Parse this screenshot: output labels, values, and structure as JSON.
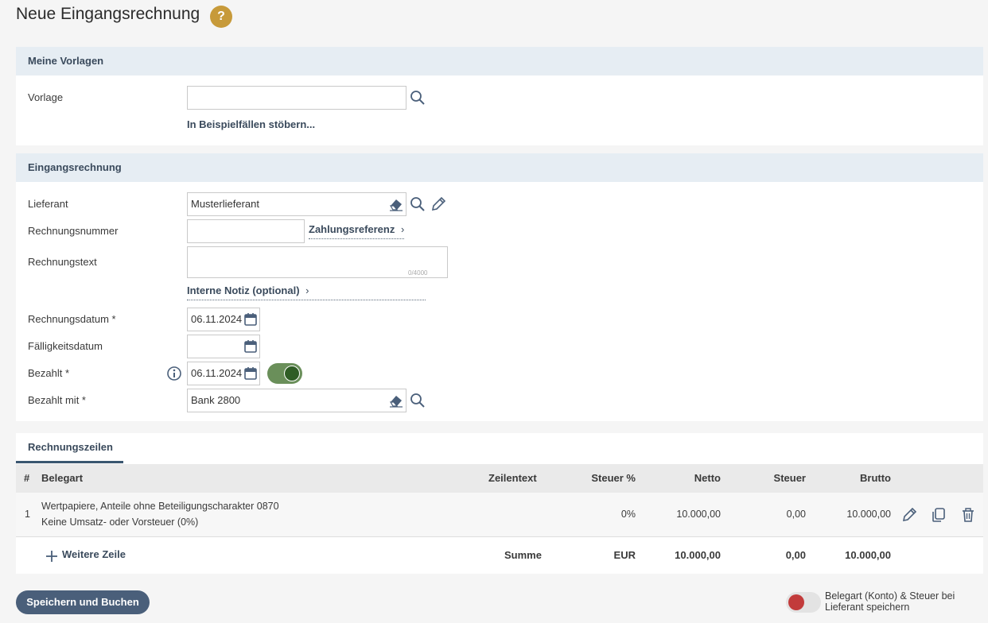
{
  "page": {
    "title": "Neue Eingangsrechnung",
    "help": "?"
  },
  "templates": {
    "header": "Meine Vorlagen",
    "vorlage_label": "Vorlage",
    "vorlage_value": "",
    "browse_link": "In Beispielfällen stöbern..."
  },
  "invoice": {
    "header": "Eingangsrechnung",
    "lieferant_label": "Lieferant",
    "lieferant_value": "Musterlieferant",
    "rechnungsnummer_label": "Rechnungsnummer",
    "rechnungsnummer_value": "",
    "zahlungsreferenz_link": "Zahlungsreferenz",
    "rechnungstext_label": "Rechnungstext",
    "rechnungstext_value": "",
    "rechnungstext_counter": "0/4000",
    "interne_notiz_link": "Interne Notiz (optional)",
    "rechnungsdatum_label": "Rechnungsdatum *",
    "rechnungsdatum_value": "06.11.2024",
    "faelligkeitsdatum_label": "Fälligkeitsdatum",
    "faelligkeitsdatum_value": "",
    "bezahlt_label": "Bezahlt *",
    "bezahlt_value": "06.11.2024",
    "bezahlt_toggle": true,
    "bezahlt_mit_label": "Bezahlt mit *",
    "bezahlt_mit_value": "Bank 2800"
  },
  "lines": {
    "tab": "Rechnungszeilen",
    "columns": [
      "#",
      "Belegart",
      "Zeilentext",
      "Steuer %",
      "Netto",
      "Steuer",
      "Brutto"
    ],
    "rows": [
      {
        "num": "1",
        "belegart": "Wertpapiere, Anteile ohne Beteiligungscharakter 0870",
        "belegart_sub": "Keine Umsatz- oder Vorsteuer (0%)",
        "zeilentext": "",
        "steuer_pct": "0%",
        "netto": "10.000,00",
        "steuer": "0,00",
        "brutto": "10.000,00"
      }
    ],
    "add_row": "Weitere Zeile",
    "sum_label": "Summe",
    "currency": "EUR",
    "sum_netto": "10.000,00",
    "sum_steuer": "0,00",
    "sum_brutto": "10.000,00"
  },
  "footer": {
    "save_button": "Speichern und Buchen",
    "save_toggle": false,
    "save_toggle_label": "Belegart (Konto) & Steuer bei Lieferant speichern"
  },
  "colors": {
    "accent": "#4a5f7a",
    "toggle_on": "#2f5d25",
    "toggle_off_knob": "#c23b3b",
    "help": "#c79a3a"
  }
}
